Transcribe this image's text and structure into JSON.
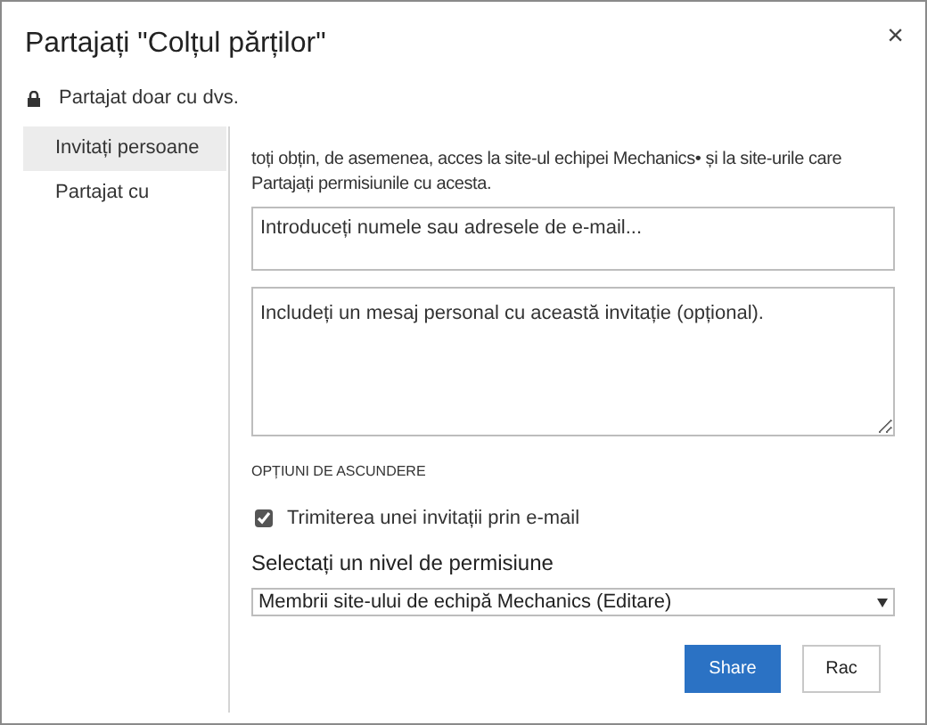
{
  "window": {
    "title": "Partajați \"Colțul părților\"",
    "close": "×"
  },
  "sharing_status": "Partajat doar cu dvs.",
  "sidebar": {
    "items": [
      {
        "label": "Invitați persoane",
        "selected": true
      },
      {
        "label": "Partajat cu",
        "selected": false
      }
    ]
  },
  "intro": "toți obțin, de asemenea, acces la site-ul echipei Mechanics• și la site-urile care Partajați permisiunile cu acesta.",
  "people_field": {
    "placeholder": "Introduceți numele sau adresele de e-mail..."
  },
  "message_field": {
    "placeholder": "Includeți un mesaj personal cu această invitație (opțional)."
  },
  "options_heading": "OPȚIUNI DE ASCUNDERE",
  "send_email": {
    "label": "Trimiterea unei invitații prin e-mail",
    "checked": true
  },
  "permission": {
    "label": "Selectați un nivel de permisiune",
    "value": "Membrii site-ului de echipă Mechanics (Editare)"
  },
  "buttons": [
    {
      "label": "Share",
      "kind": "primary"
    },
    {
      "label": "Rac",
      "kind": "secondary"
    }
  ]
}
